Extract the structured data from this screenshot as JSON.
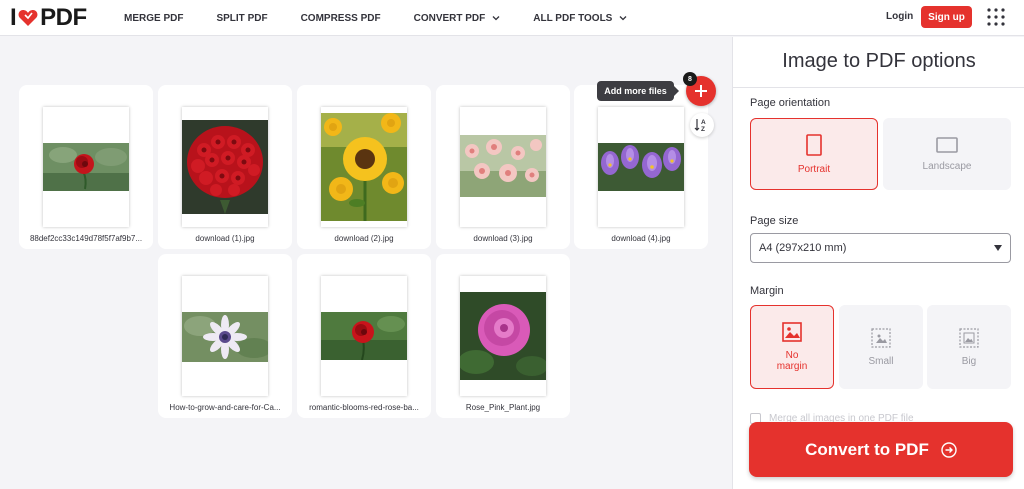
{
  "header": {
    "logo_left": "I",
    "logo_right": "PDF",
    "nav": [
      {
        "label": "MERGE PDF",
        "dropdown": false
      },
      {
        "label": "SPLIT PDF",
        "dropdown": false
      },
      {
        "label": "COMPRESS PDF",
        "dropdown": false
      },
      {
        "label": "CONVERT PDF",
        "dropdown": true
      },
      {
        "label": "ALL PDF TOOLS",
        "dropdown": true
      }
    ],
    "login": "Login",
    "signup": "Sign up"
  },
  "workspace": {
    "files": [
      {
        "name": "88def2cc33c149d78f5f7af9b7...",
        "photo": "rose-red-single"
      },
      {
        "name": "download (1).jpg",
        "photo": "rose-bouquet"
      },
      {
        "name": "download (2).jpg",
        "photo": "sunflowers"
      },
      {
        "name": "download (3).jpg",
        "photo": "pink-flowers"
      },
      {
        "name": "download (4).jpg",
        "photo": "purple-crocus"
      },
      {
        "name": "How-to-grow-and-care-for-Ca...",
        "photo": "white-daisy"
      },
      {
        "name": "romantic-blooms-red-rose-ba...",
        "photo": "rose-red-single"
      },
      {
        "name": "Rose_Pink_Plant.jpg",
        "photo": "pink-rose"
      }
    ],
    "add_tooltip": "Add more files",
    "file_count": "8"
  },
  "sidebar": {
    "title": "Image to PDF options",
    "orientation_label": "Page orientation",
    "portrait": "Portrait",
    "landscape": "Landscape",
    "page_size_label": "Page size",
    "page_size_value": "A4 (297x210 mm)",
    "margin_label": "Margin",
    "margin_none_1": "No",
    "margin_none_2": "margin",
    "margin_small": "Small",
    "margin_big": "Big",
    "merge_text": "Merge all images in one PDF file",
    "convert_button": "Convert to PDF"
  },
  "colors": {
    "accent": "#e5322d",
    "dark": "#33333b"
  }
}
